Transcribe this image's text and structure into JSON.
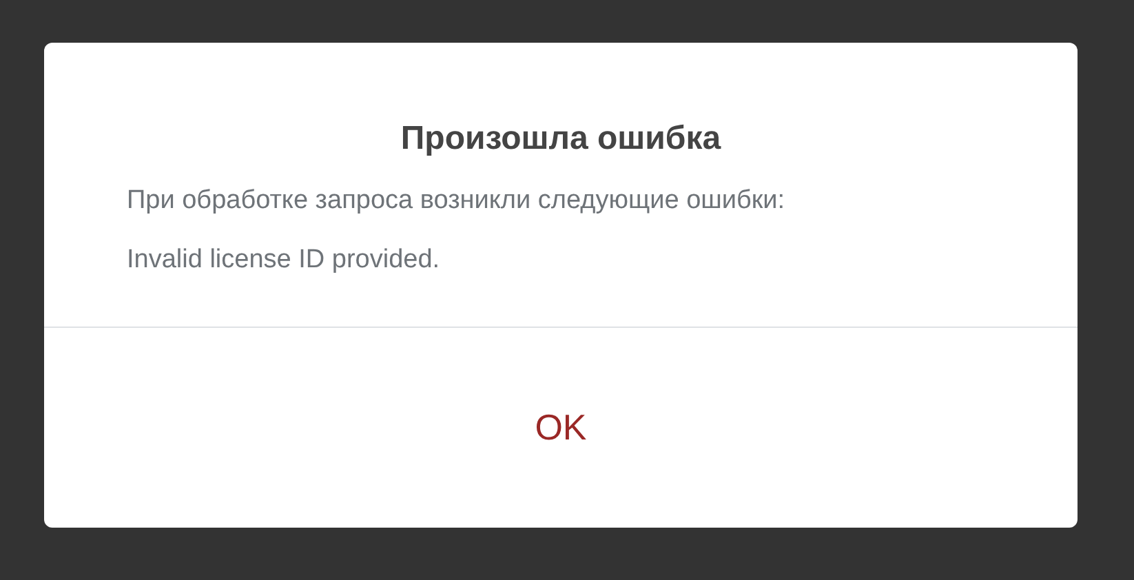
{
  "dialog": {
    "title": "Произошла ошибка",
    "messages": [
      "При обработке запроса возникли следующие ошибки:",
      "Invalid license ID provided."
    ],
    "buttons": [
      "OK"
    ]
  }
}
